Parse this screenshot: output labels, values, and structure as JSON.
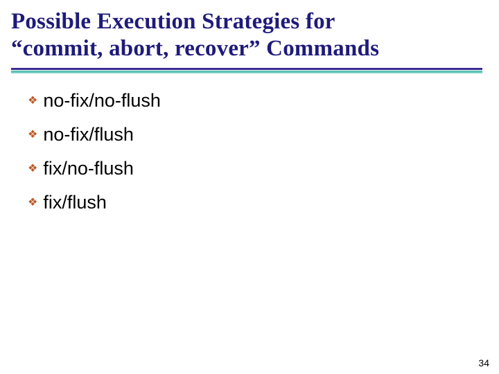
{
  "title_line1": "Possible Execution Strategies for",
  "title_line2": "“commit, abort, recover” Commands",
  "bullets": {
    "b0": "no-fix/no-flush",
    "b1": "no-fix/flush",
    "b2": "fix/no-flush",
    "b3": "fix/flush"
  },
  "page_number": "34"
}
